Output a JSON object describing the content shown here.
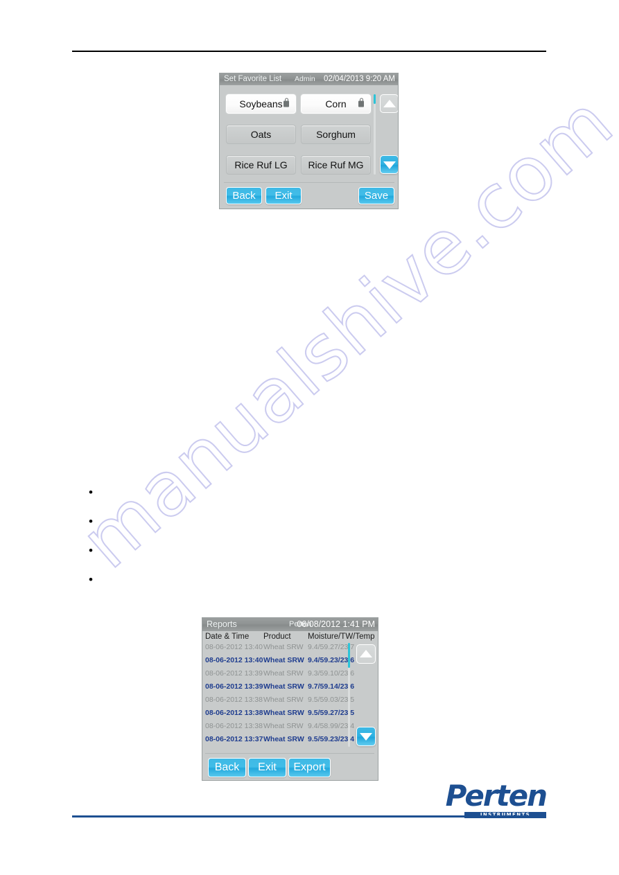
{
  "document": {
    "watermark_text": "manualshive.com",
    "brand": {
      "name": "Perten",
      "tagline": "INSTRUMENTS",
      "color": "#1d4f91"
    },
    "bullets": [
      {
        "text": ""
      },
      {
        "text": ""
      },
      {
        "text": ""
      },
      {
        "text": ""
      }
    ]
  },
  "favorite_screen": {
    "titlebar": {
      "title": "Set Favorite List",
      "user": "Admin",
      "datetime": "02/04/2013 9:20 AM"
    },
    "grain_buttons": [
      {
        "label": "Soybeans",
        "locked": true,
        "selected": true
      },
      {
        "label": "Corn",
        "locked": true,
        "selected": true
      },
      {
        "label": "Oats",
        "locked": false,
        "selected": false
      },
      {
        "label": "Sorghum",
        "locked": false,
        "selected": false
      },
      {
        "label": "Rice Ruf LG",
        "locked": false,
        "selected": false
      },
      {
        "label": "Rice Ruf MG",
        "locked": false,
        "selected": false
      }
    ],
    "scroll": {
      "up_icon": "triangle-up-icon",
      "down_icon": "triangle-down-icon",
      "up_enabled": false,
      "down_enabled": true
    },
    "buttons": {
      "back": "Back",
      "exit": "Exit",
      "save": "Save"
    }
  },
  "reports_screen": {
    "titlebar": {
      "title": "Reports",
      "user": "Perten",
      "datetime": "06/08/2012 1:41 PM"
    },
    "columns": [
      "Date & Time",
      "Product",
      "Moisture/TW/Temp"
    ],
    "rows": [
      {
        "datetime": "08-06-2012 13:40",
        "product": "Wheat SRW",
        "measurement": "9.4/59.27/23.7"
      },
      {
        "datetime": "08-06-2012 13:40",
        "product": "Wheat SRW",
        "measurement": "9.4/59.23/23.6"
      },
      {
        "datetime": "08-06-2012 13:39",
        "product": "Wheat SRW",
        "measurement": "9.3/59.10/23.6"
      },
      {
        "datetime": "08-06-2012 13:39",
        "product": "Wheat SRW",
        "measurement": "9.7/59.14/23.6"
      },
      {
        "datetime": "08-06-2012 13:38",
        "product": "Wheat SRW",
        "measurement": "9.5/59.03/23.5"
      },
      {
        "datetime": "08-06-2012 13:38",
        "product": "Wheat SRW",
        "measurement": "9.5/59.27/23.5"
      },
      {
        "datetime": "08-06-2012 13:38",
        "product": "Wheat SRW",
        "measurement": "9.4/58.99/23.4"
      },
      {
        "datetime": "08-06-2012 13:37",
        "product": "Wheat SRW",
        "measurement": "9.5/59.23/23.4"
      }
    ],
    "scroll": {
      "up_icon": "triangle-up-icon",
      "down_icon": "triangle-down-icon",
      "up_enabled": false,
      "down_enabled": true
    },
    "buttons": {
      "back": "Back",
      "exit": "Exit",
      "export": "Export"
    }
  }
}
